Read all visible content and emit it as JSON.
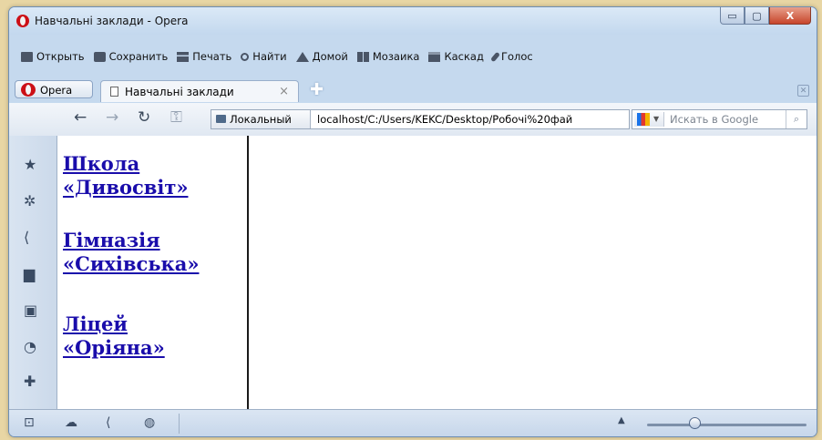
{
  "window": {
    "title": "Навчальні заклади - Opera",
    "min_glyph": "▭",
    "max_glyph": "▢",
    "close_glyph": "X"
  },
  "menubar": {
    "items": [
      {
        "label": "Открыть",
        "icon": "folder-icon"
      },
      {
        "label": "Сохранить",
        "icon": "save-icon"
      },
      {
        "label": "Печать",
        "icon": "print-icon"
      },
      {
        "label": "Найти",
        "icon": "find-icon"
      },
      {
        "label": "Домой",
        "icon": "home-icon"
      },
      {
        "label": "Мозаика",
        "icon": "tile-icon"
      },
      {
        "label": "Каскад",
        "icon": "cascade-icon"
      },
      {
        "label": "Голос",
        "icon": "voice-icon"
      }
    ]
  },
  "tabs": {
    "opera_menu_label": "Opera",
    "active_tab_label": "Навчальні заклади",
    "close_glyph": "×",
    "new_tab_glyph": "✚",
    "trash_glyph": "✕"
  },
  "navbar": {
    "back_glyph": "←",
    "forward_glyph": "→",
    "reload_glyph": "↻",
    "key_glyph": "⚿",
    "address_segment": "Локальный",
    "url": "localhost/C:/Users/KEKC/Desktop/Робочі%20фай",
    "search_placeholder": "Искать в Google",
    "search_glyph": "⌕"
  },
  "panel": {
    "items": [
      "bookmarks-icon",
      "settings-icon",
      "unite-icon",
      "notes-icon",
      "downloads-icon",
      "history-icon",
      "add-icon"
    ]
  },
  "content": {
    "links": [
      {
        "line1": "Школа",
        "line2": "«Дивосвіт»"
      },
      {
        "line1": "Гімназія",
        "line2": "«Сихівська»"
      },
      {
        "line1": "Ліцей",
        "line2": "«Оріяна»"
      }
    ]
  },
  "colors": {
    "link": "#1a0dab",
    "opera_red": "#cc0f16",
    "chrome": "#c5d9ee"
  }
}
